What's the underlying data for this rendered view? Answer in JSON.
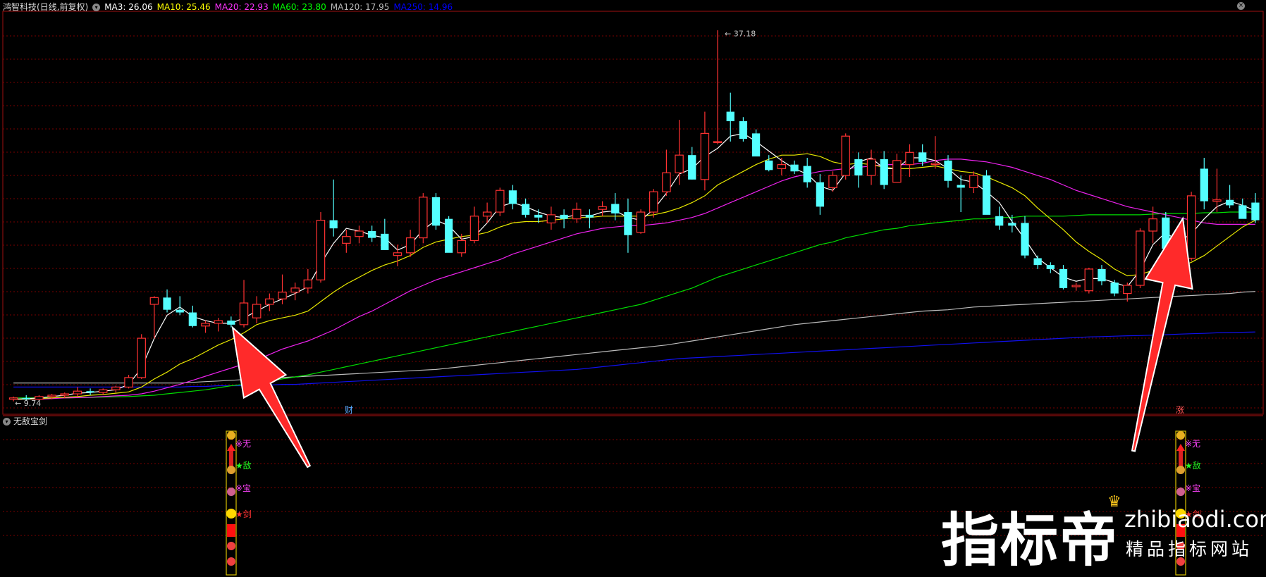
{
  "header": {
    "stock": "鸿智科技(日线,前复权)",
    "ma": [
      {
        "label": "MA3: 26.06",
        "color": "#ffffff"
      },
      {
        "label": "MA10: 25.46",
        "color": "#ffff00"
      },
      {
        "label": "MA20: 22.93",
        "color": "#ff33ff"
      },
      {
        "label": "MA60: 23.80",
        "color": "#00ff00"
      },
      {
        "label": "MA120: 17.95",
        "color": "#bbbbbb"
      },
      {
        "label": "MA250: 14.96",
        "color": "#0000ff"
      }
    ]
  },
  "subpanel": {
    "title": "无敌宝剑"
  },
  "markers": {
    "cai": "财",
    "zhang": "涨",
    "hi": "37.18",
    "lo": "9.74"
  },
  "signal_labels": [
    "※无",
    "★敌",
    "※宝",
    "★剑"
  ],
  "watermark": {
    "big": "指标帝",
    "url": "zhibiaodi.com",
    "sub": "精品指标网站"
  },
  "chart_data": {
    "type": "candlestick",
    "ylim": [
      9.0,
      38.5
    ],
    "up_color": "#ff3232",
    "down_color": "#54ffff",
    "ohlc": [
      [
        10.0,
        10.2,
        9.85,
        10.1
      ],
      [
        10.1,
        10.3,
        9.9,
        10.0
      ],
      [
        10.0,
        10.3,
        9.9,
        10.2
      ],
      [
        10.2,
        10.4,
        10.0,
        10.3
      ],
      [
        10.3,
        10.5,
        10.1,
        10.4
      ],
      [
        10.4,
        10.9,
        10.2,
        10.6
      ],
      [
        10.6,
        10.8,
        10.3,
        10.5
      ],
      [
        10.5,
        10.8,
        10.3,
        10.7
      ],
      [
        10.7,
        11.0,
        10.5,
        10.9
      ],
      [
        10.9,
        11.8,
        10.8,
        11.6
      ],
      [
        11.6,
        14.8,
        11.5,
        14.5
      ],
      [
        17.0,
        17.6,
        14.5,
        17.5
      ],
      [
        17.5,
        18.1,
        16.4,
        16.6
      ],
      [
        16.6,
        17.6,
        16.2,
        16.4
      ],
      [
        16.4,
        16.9,
        15.3,
        15.4
      ],
      [
        15.4,
        15.8,
        14.9,
        15.6
      ],
      [
        15.6,
        16.0,
        15.0,
        15.8
      ],
      [
        15.8,
        16.1,
        15.3,
        15.5
      ],
      [
        15.5,
        18.8,
        15.3,
        17.1
      ],
      [
        16.0,
        17.6,
        15.6,
        17.0
      ],
      [
        17.0,
        17.8,
        16.5,
        17.4
      ],
      [
        17.4,
        19.2,
        17.0,
        17.9
      ],
      [
        17.9,
        18.6,
        17.3,
        18.2
      ],
      [
        18.2,
        19.6,
        17.8,
        18.8
      ],
      [
        18.8,
        23.8,
        18.6,
        23.2
      ],
      [
        23.2,
        26.2,
        22.0,
        22.6
      ],
      [
        21.5,
        22.5,
        20.8,
        22.0
      ],
      [
        22.0,
        22.8,
        21.5,
        22.4
      ],
      [
        22.4,
        22.8,
        21.6,
        21.9
      ],
      [
        22.2,
        23.3,
        21.8,
        21.0
      ],
      [
        20.6,
        21.4,
        19.8,
        20.8
      ],
      [
        20.8,
        22.5,
        20.5,
        21.9
      ],
      [
        21.9,
        25.2,
        21.5,
        24.9
      ],
      [
        24.9,
        25.2,
        22.5,
        22.8
      ],
      [
        23.3,
        23.5,
        21.1,
        20.8
      ],
      [
        20.8,
        22.2,
        20.5,
        21.7
      ],
      [
        21.7,
        24.2,
        21.5,
        23.5
      ],
      [
        23.5,
        24.5,
        23.0,
        23.8
      ],
      [
        23.8,
        25.6,
        23.5,
        25.4
      ],
      [
        25.4,
        25.8,
        24.0,
        24.4
      ],
      [
        24.4,
        24.8,
        23.4,
        23.6
      ],
      [
        23.6,
        24.0,
        23.0,
        23.4
      ],
      [
        23.0,
        24.2,
        22.5,
        23.6
      ],
      [
        23.6,
        24.0,
        22.6,
        23.3
      ],
      [
        23.3,
        24.5,
        23.0,
        24.0
      ],
      [
        23.6,
        24.0,
        22.6,
        23.4
      ],
      [
        24.0,
        24.6,
        23.5,
        24.2
      ],
      [
        24.4,
        25.2,
        23.2,
        23.7
      ],
      [
        23.8,
        24.8,
        20.8,
        22.1
      ],
      [
        22.3,
        24.0,
        22.2,
        23.8
      ],
      [
        23.8,
        25.5,
        23.4,
        25.3
      ],
      [
        25.3,
        28.4,
        25.0,
        26.7
      ],
      [
        26.7,
        30.6,
        25.8,
        28.0
      ],
      [
        28.0,
        28.6,
        26.2,
        26.2
      ],
      [
        26.2,
        31.2,
        25.4,
        29.6
      ],
      [
        29.0,
        37.2,
        28.8,
        29.0
      ],
      [
        31.2,
        32.6,
        29.0,
        30.5
      ],
      [
        30.5,
        30.8,
        29.0,
        29.2
      ],
      [
        29.6,
        29.9,
        28.0,
        27.9
      ],
      [
        27.6,
        28.0,
        26.8,
        26.9
      ],
      [
        27.0,
        27.8,
        26.5,
        27.3
      ],
      [
        27.3,
        27.6,
        26.6,
        26.8
      ],
      [
        27.2,
        27.8,
        25.6,
        26.0
      ],
      [
        26.0,
        26.6,
        23.6,
        24.2
      ],
      [
        25.6,
        26.8,
        25.3,
        26.5
      ],
      [
        26.5,
        29.6,
        26.2,
        29.4
      ],
      [
        27.7,
        28.2,
        25.6,
        26.5
      ],
      [
        26.5,
        28.4,
        25.8,
        27.7
      ],
      [
        27.7,
        28.3,
        25.5,
        25.8
      ],
      [
        26.0,
        28.1,
        26.0,
        27.6
      ],
      [
        27.3,
        28.8,
        26.4,
        28.2
      ],
      [
        28.2,
        28.8,
        27.2,
        27.5
      ],
      [
        27.3,
        29.4,
        27.0,
        27.4
      ],
      [
        27.6,
        28.0,
        25.6,
        26.1
      ],
      [
        25.8,
        26.5,
        23.8,
        25.6
      ],
      [
        25.6,
        26.8,
        25.2,
        26.5
      ],
      [
        26.5,
        26.9,
        23.9,
        23.6
      ],
      [
        23.5,
        24.2,
        22.5,
        22.8
      ],
      [
        23.0,
        23.6,
        22.3,
        22.8
      ],
      [
        23.0,
        23.5,
        20.4,
        20.6
      ],
      [
        20.4,
        20.6,
        19.6,
        19.9
      ],
      [
        19.9,
        20.1,
        19.3,
        19.6
      ],
      [
        19.6,
        19.9,
        18.1,
        18.2
      ],
      [
        18.3,
        18.6,
        18.0,
        18.4
      ],
      [
        18.0,
        19.7,
        17.8,
        19.6
      ],
      [
        19.6,
        19.9,
        18.4,
        18.7
      ],
      [
        18.6,
        18.8,
        17.6,
        17.8
      ],
      [
        17.8,
        18.6,
        17.2,
        18.4
      ],
      [
        18.4,
        22.6,
        18.2,
        22.4
      ],
      [
        22.4,
        24.2,
        21.5,
        23.3
      ],
      [
        23.4,
        23.8,
        20.8,
        21.1
      ],
      [
        20.9,
        21.2,
        20.5,
        20.5
      ],
      [
        20.4,
        25.3,
        20.2,
        25.0
      ],
      [
        27.0,
        27.8,
        24.0,
        24.6
      ],
      [
        24.6,
        27.0,
        23.8,
        24.7
      ],
      [
        24.7,
        25.8,
        24.1,
        24.3
      ],
      [
        24.3,
        24.8,
        23.4,
        23.3
      ],
      [
        24.5,
        25.2,
        23.0,
        23.2
      ]
    ],
    "ma3": [
      10.0,
      10.05,
      10.1,
      10.2,
      10.3,
      10.45,
      10.5,
      10.6,
      10.7,
      11.1,
      12.3,
      14.5,
      16.2,
      16.8,
      16.1,
      15.8,
      15.6,
      15.6,
      16.0,
      16.5,
      17.0,
      17.4,
      17.8,
      18.3,
      20.0,
      21.5,
      22.6,
      22.4,
      22.1,
      21.9,
      21.0,
      21.4,
      22.5,
      23.2,
      22.8,
      21.8,
      22.0,
      23.0,
      24.2,
      24.5,
      24.2,
      23.8,
      23.5,
      23.4,
      23.6,
      23.5,
      23.8,
      23.9,
      23.4,
      23.2,
      24.0,
      25.2,
      26.6,
      27.0,
      27.9,
      28.5,
      29.4,
      29.6,
      29.0,
      28.3,
      27.6,
      27.0,
      26.6,
      25.7,
      25.4,
      26.7,
      27.5,
      27.8,
      27.0,
      27.0,
      27.8,
      27.8,
      27.6,
      27.0,
      26.2,
      26.0,
      25.3,
      24.5,
      23.1,
      21.8,
      20.4,
      19.7,
      19.0,
      18.7,
      18.9,
      18.9,
      18.6,
      18.3,
      19.5,
      21.4,
      22.3,
      21.6,
      22.2,
      23.3,
      24.2,
      24.6,
      24.3,
      23.9
    ],
    "ma10": [
      10.0,
      10.0,
      10.05,
      10.1,
      10.15,
      10.2,
      10.3,
      10.35,
      10.45,
      10.55,
      10.9,
      11.5,
      12.0,
      12.6,
      13.0,
      13.5,
      14.0,
      14.4,
      14.9,
      15.5,
      15.8,
      16.0,
      16.2,
      16.5,
      17.2,
      17.9,
      18.5,
      19.0,
      19.5,
      19.9,
      20.2,
      20.6,
      21.2,
      21.6,
      21.8,
      22.0,
      22.1,
      22.3,
      22.7,
      23.0,
      23.1,
      23.1,
      23.2,
      23.3,
      23.4,
      23.4,
      23.5,
      23.5,
      23.5,
      23.5,
      23.6,
      23.8,
      24.1,
      24.5,
      25.0,
      25.8,
      26.3,
      26.8,
      27.3,
      27.7,
      28.0,
      28.0,
      28.1,
      27.9,
      27.5,
      27.3,
      27.4,
      27.3,
      27.1,
      27.0,
      27.0,
      27.1,
      27.2,
      27.0,
      26.8,
      26.7,
      26.4,
      26.0,
      25.6,
      25.0,
      24.1,
      23.3,
      22.5,
      21.6,
      20.9,
      20.3,
      19.6,
      19.1,
      19.2,
      19.5,
      19.7,
      19.7,
      20.1,
      20.6,
      21.3,
      22.0,
      22.7,
      23.2
    ],
    "ma20": [
      10.0,
      10.0,
      10.0,
      10.05,
      10.1,
      10.12,
      10.15,
      10.2,
      10.25,
      10.3,
      10.4,
      10.6,
      10.85,
      11.1,
      11.4,
      11.7,
      12.0,
      12.3,
      12.6,
      12.9,
      13.3,
      13.7,
      14.0,
      14.3,
      14.7,
      15.1,
      15.6,
      16.1,
      16.5,
      17.0,
      17.5,
      18.0,
      18.4,
      18.8,
      19.1,
      19.4,
      19.7,
      20.0,
      20.3,
      20.7,
      21.0,
      21.3,
      21.6,
      21.9,
      22.2,
      22.4,
      22.6,
      22.7,
      22.8,
      22.8,
      22.9,
      23.0,
      23.2,
      23.4,
      23.7,
      24.1,
      24.5,
      24.9,
      25.3,
      25.7,
      26.1,
      26.4,
      26.6,
      26.8,
      26.9,
      27.0,
      27.1,
      27.2,
      27.3,
      27.3,
      27.3,
      27.4,
      27.6,
      27.7,
      27.7,
      27.6,
      27.5,
      27.3,
      27.1,
      26.8,
      26.5,
      26.2,
      25.8,
      25.4,
      25.1,
      24.8,
      24.5,
      24.2,
      24.0,
      23.8,
      23.6,
      23.4,
      23.2,
      23.0,
      22.9,
      22.9,
      22.9,
      22.9
    ],
    "ma60": [
      10.1,
      10.1,
      10.1,
      10.1,
      10.1,
      10.12,
      10.14,
      10.16,
      10.18,
      10.2,
      10.25,
      10.3,
      10.4,
      10.5,
      10.6,
      10.7,
      10.85,
      11.0,
      11.1,
      11.2,
      11.35,
      11.5,
      11.65,
      11.8,
      12.0,
      12.2,
      12.4,
      12.6,
      12.8,
      13.0,
      13.2,
      13.4,
      13.6,
      13.8,
      14.0,
      14.2,
      14.4,
      14.6,
      14.8,
      15.0,
      15.2,
      15.4,
      15.6,
      15.8,
      16.0,
      16.2,
      16.4,
      16.6,
      16.8,
      17.0,
      17.3,
      17.6,
      17.9,
      18.2,
      18.6,
      19.0,
      19.3,
      19.6,
      19.9,
      20.2,
      20.5,
      20.8,
      21.1,
      21.4,
      21.6,
      21.9,
      22.1,
      22.3,
      22.5,
      22.6,
      22.8,
      22.9,
      23.0,
      23.1,
      23.2,
      23.3,
      23.3,
      23.4,
      23.4,
      23.5,
      23.5,
      23.5,
      23.5,
      23.55,
      23.6,
      23.6,
      23.6,
      23.6,
      23.6,
      23.65,
      23.7,
      23.7,
      23.7,
      23.75,
      23.75,
      23.8,
      23.8,
      23.8
    ],
    "ma120": [
      11.2,
      11.2,
      11.2,
      11.2,
      11.2,
      11.2,
      11.2,
      11.2,
      11.2,
      11.2,
      11.2,
      11.2,
      11.2,
      11.2,
      11.25,
      11.3,
      11.35,
      11.4,
      11.45,
      11.5,
      11.55,
      11.6,
      11.65,
      11.7,
      11.75,
      11.8,
      11.85,
      11.9,
      11.95,
      12.0,
      12.05,
      12.1,
      12.15,
      12.2,
      12.3,
      12.4,
      12.5,
      12.6,
      12.7,
      12.8,
      12.9,
      13.0,
      13.1,
      13.2,
      13.3,
      13.4,
      13.5,
      13.6,
      13.7,
      13.8,
      13.9,
      14.0,
      14.15,
      14.3,
      14.45,
      14.6,
      14.75,
      14.9,
      15.05,
      15.2,
      15.35,
      15.5,
      15.6,
      15.7,
      15.8,
      15.9,
      16.0,
      16.1,
      16.2,
      16.3,
      16.4,
      16.5,
      16.55,
      16.6,
      16.7,
      16.8,
      16.85,
      16.9,
      16.95,
      17.0,
      17.05,
      17.1,
      17.15,
      17.2,
      17.25,
      17.3,
      17.35,
      17.4,
      17.45,
      17.5,
      17.55,
      17.6,
      17.65,
      17.7,
      17.75,
      17.8,
      17.9,
      17.95
    ],
    "ma250": [
      10.9,
      10.9,
      10.9,
      10.9,
      10.9,
      10.9,
      10.9,
      10.9,
      10.9,
      10.9,
      10.9,
      10.9,
      10.9,
      10.9,
      10.95,
      10.95,
      11.0,
      11.0,
      11.0,
      11.05,
      11.05,
      11.1,
      11.1,
      11.15,
      11.2,
      11.25,
      11.3,
      11.35,
      11.4,
      11.45,
      11.5,
      11.55,
      11.6,
      11.65,
      11.7,
      11.75,
      11.8,
      11.85,
      11.9,
      11.95,
      12.0,
      12.05,
      12.1,
      12.15,
      12.2,
      12.3,
      12.4,
      12.5,
      12.6,
      12.7,
      12.8,
      12.9,
      13.0,
      13.05,
      13.1,
      13.15,
      13.2,
      13.25,
      13.3,
      13.35,
      13.4,
      13.45,
      13.5,
      13.55,
      13.6,
      13.65,
      13.7,
      13.75,
      13.8,
      13.85,
      13.9,
      13.95,
      14.0,
      14.05,
      14.1,
      14.15,
      14.2,
      14.25,
      14.3,
      14.35,
      14.4,
      14.45,
      14.5,
      14.55,
      14.6,
      14.62,
      14.65,
      14.68,
      14.7,
      14.73,
      14.76,
      14.8,
      14.83,
      14.86,
      14.9,
      14.92,
      14.94,
      14.96
    ]
  }
}
